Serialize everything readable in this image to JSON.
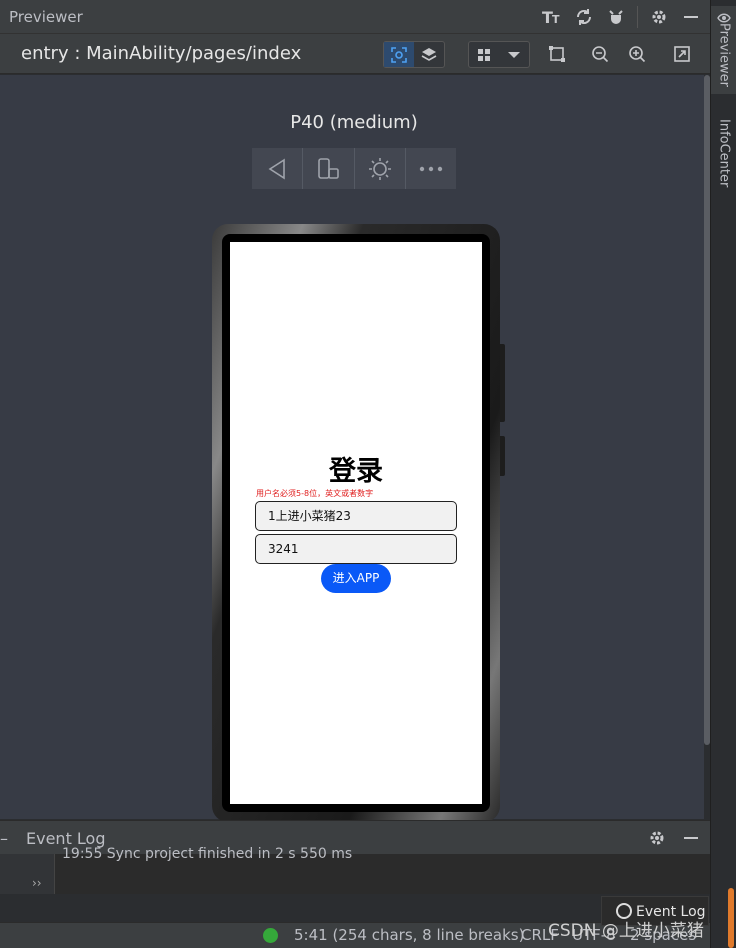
{
  "panel": {
    "title": "Previewer",
    "icons": [
      "font-size-icon",
      "refresh-icon",
      "debug-icon",
      "gear-icon",
      "minimize-icon"
    ]
  },
  "pathbar": {
    "path": "entry : MainAbility/pages/index"
  },
  "right_strip": {
    "tabs": [
      "Previewer",
      "InfoCenter"
    ]
  },
  "device": {
    "name": "P40 (medium)",
    "tools": [
      "back-icon",
      "rotate-icon",
      "brightness-icon",
      "more-icon"
    ]
  },
  "app_screen": {
    "title": "登录",
    "hint": "用户名必须5-8位，英文或者数字",
    "username_value": "1上进小菜猪23",
    "password_value": "3241",
    "enter_button": "进入APP"
  },
  "event_log": {
    "title": "Event Log",
    "line": "19:55  Sync project finished in 2 s 550 ms"
  },
  "status": {
    "position": "5:41 (254 chars, 8 line breaks)",
    "line_ending": "CRLF",
    "encoding": "UTF-8",
    "indent": "2 spaces",
    "event_log_button": "Event Log",
    "watermark": "CSDN @上进小菜猪",
    "ok_color": "#35a83a"
  },
  "colors": {
    "accent": "#0a59f7",
    "hint_red": "#e02020"
  }
}
